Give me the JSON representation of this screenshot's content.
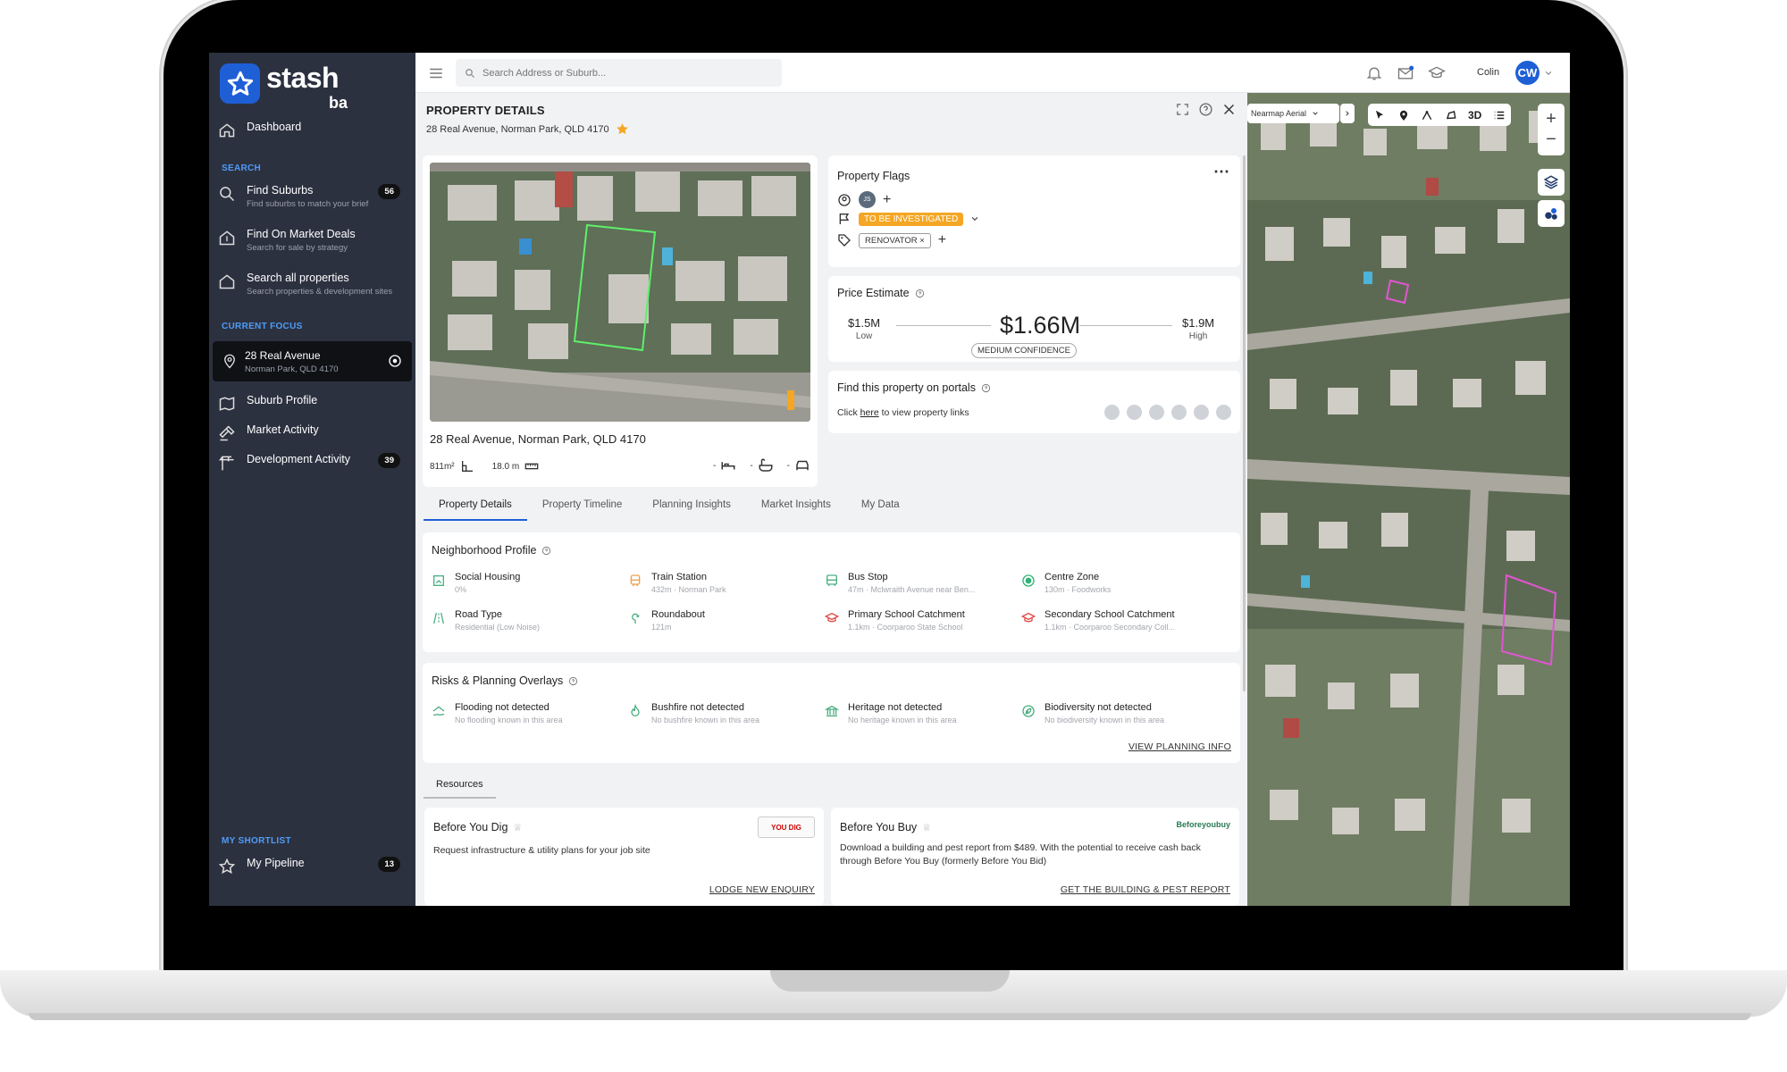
{
  "app": {
    "logo_main": "stash",
    "logo_sub": "ba"
  },
  "sidebar": {
    "dashboard": "Dashboard",
    "search_section": "SEARCH",
    "find_suburbs": {
      "title": "Find Suburbs",
      "sub": "Find suburbs to match your brief",
      "count": "56"
    },
    "find_market": {
      "title": "Find On Market Deals",
      "sub": "Search for sale by strategy"
    },
    "search_all": {
      "title": "Search all properties",
      "sub": "Search properties & development sites"
    },
    "focus_section": "CURRENT FOCUS",
    "focus": {
      "title": "28 Real Avenue",
      "sub": "Norman Park, QLD 4170"
    },
    "suburb_profile": "Suburb Profile",
    "market_activity": "Market Activity",
    "development_activity": {
      "title": "Development Activity",
      "count": "39"
    },
    "shortlist_section": "MY SHORTLIST",
    "my_pipeline": {
      "title": "My Pipeline",
      "count": "13"
    }
  },
  "topbar": {
    "search_placeholder": "Search Address or Suburb...",
    "user_name": "Colin",
    "user_initials": "CW"
  },
  "panel": {
    "title": "PROPERTY DETAILS",
    "address": "28 Real Avenue, Norman Park, QLD 4170",
    "card_address": "28 Real Avenue, Norman Park, QLD 4170",
    "land_area": "811m²",
    "frontage": "18.0 m",
    "beds": "-",
    "baths": "-",
    "cars": "-"
  },
  "flags": {
    "title": "Property Flags",
    "avatar": "JS",
    "status": "TO BE INVESTIGATED",
    "tag": "RENOVATOR"
  },
  "price": {
    "title": "Price Estimate",
    "low": "$1.5M",
    "low_label": "Low",
    "mid": "$1.66M",
    "high": "$1.9M",
    "high_label": "High",
    "confidence": "MEDIUM CONFIDENCE"
  },
  "portals": {
    "title": "Find this property on portals",
    "pre": "Click ",
    "link": "here",
    "post": " to view property links"
  },
  "tabs": [
    "Property Details",
    "Property Timeline",
    "Planning Insights",
    "Market Insights",
    "My Data"
  ],
  "neighborhood": {
    "title": "Neighborhood Profile",
    "items": [
      {
        "name": "Social Housing",
        "detail": "0%"
      },
      {
        "name": "Train Station",
        "detail": "432m · Norman Park"
      },
      {
        "name": "Bus Stop",
        "detail": "47m · Mclwraith Avenue near Ben..."
      },
      {
        "name": "Centre Zone",
        "detail": "130m · Foodworks"
      },
      {
        "name": "Road Type",
        "detail": "Residential (Low Noise)"
      },
      {
        "name": "Roundabout",
        "detail": "121m"
      },
      {
        "name": "Primary School Catchment",
        "detail": "1.1km · Coorparoo State School"
      },
      {
        "name": "Secondary School Catchment",
        "detail": "1.1km · Coorparoo Secondary Coll..."
      }
    ]
  },
  "risks": {
    "title": "Risks & Planning Overlays",
    "items": [
      {
        "name": "Flooding not detected",
        "detail": "No flooding known in this area"
      },
      {
        "name": "Bushfire not detected",
        "detail": "No bushfire known in this area"
      },
      {
        "name": "Heritage not detected",
        "detail": "No heritage known in this area"
      },
      {
        "name": "Biodiversity not detected",
        "detail": "No biodiversity known in this area"
      }
    ],
    "link": "VIEW PLANNING INFO"
  },
  "resources": {
    "tab": "Resources",
    "dig": {
      "title": "Before You Dig",
      "desc": "Request infrastructure & utility plans for your job site",
      "link": "LODGE NEW ENQUIRY",
      "logo": "YOU DIG"
    },
    "buy": {
      "title": "Before You Buy",
      "desc": "Download a building and pest report from $489. With the potential to receive cash back through Before You Buy (formerly Before You Bid)",
      "link": "GET THE BUILDING & PEST REPORT",
      "logo": "Beforeyoubuy"
    }
  },
  "map": {
    "layer": "Nearmap Aerial",
    "btn_3d": "3D"
  },
  "colors": {
    "accent": "#1f5fd6",
    "sidebar": "#2c3140",
    "flag": "#f5a623"
  }
}
